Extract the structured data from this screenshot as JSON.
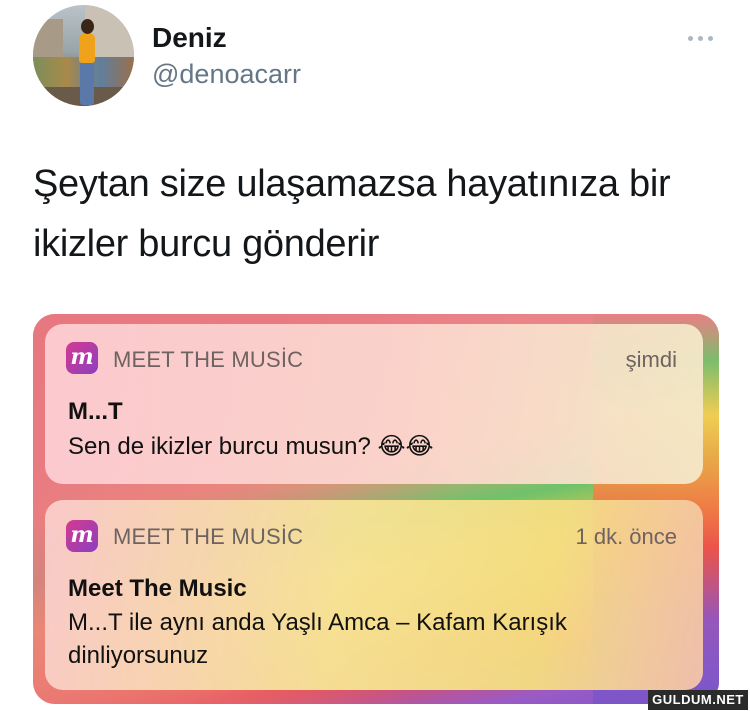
{
  "tweet": {
    "display_name": "Deniz",
    "handle": "@denoacarr",
    "text": "Şeytan size ulaşamazsa hayatınıza bir ikizler burcu gönderir"
  },
  "notifications": [
    {
      "app_icon_letter": "m",
      "app_name": "MEET THE MUSİC",
      "time": "şimdi",
      "title": "M...T",
      "body": "Sen de ikizler burcu musun? 😂😂"
    },
    {
      "app_icon_letter": "m",
      "app_name": "MEET THE MUSİC",
      "time": "1 dk. önce",
      "title": "Meet The Music",
      "body": "M...T ile aynı anda Yaşlı Amca – Kafam Karışık dinliyorsunuz"
    }
  ],
  "watermark": "GULDUM.NET",
  "icons": {
    "more": "more-horizontal-icon",
    "app": "meet-the-music-app-icon"
  }
}
